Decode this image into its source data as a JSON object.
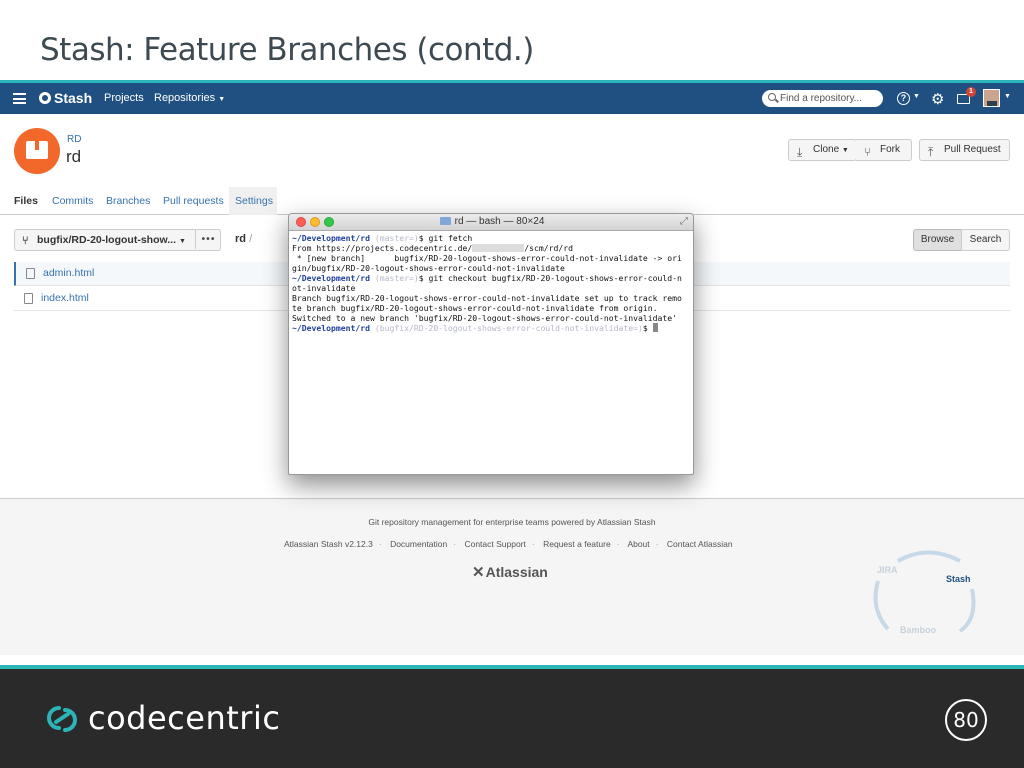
{
  "slide": {
    "title": "Stash: Feature Branches (contd.)",
    "brand": "codecentric",
    "page_number": "80",
    "accent_color": "#2bb5b8"
  },
  "topnav": {
    "logo": "Stash",
    "projects": "Projects",
    "repositories": "Repositories",
    "search_placeholder": "Find a repository...",
    "notification_count": "1",
    "nav_color": "#205081"
  },
  "repo": {
    "project": "RD",
    "name": "rd",
    "buttons": {
      "clone": "Clone",
      "fork": "Fork",
      "pull_request": "Pull Request"
    }
  },
  "tabs": [
    "Files",
    "Commits",
    "Branches",
    "Pull requests",
    "Settings"
  ],
  "files": {
    "branch": "bugfix/RD-20-logout-show...",
    "more": "•••",
    "path": "rd",
    "path_sep": "/",
    "browse": "Browse",
    "search": "Search",
    "items": [
      "admin.html",
      "index.html"
    ]
  },
  "footer": {
    "tagline": "Git repository management for enterprise teams powered by Atlassian Stash",
    "links": [
      "Atlassian Stash v2.12.3",
      "Documentation",
      "Contact Support",
      "Request a feature",
      "About",
      "Contact Atlassian"
    ],
    "logo": "Atlassian",
    "cycle": {
      "jira": "JIRA",
      "stash": "Stash",
      "bamboo": "Bamboo"
    }
  },
  "terminal": {
    "title": "rd — bash — 80×24",
    "prompt_path": "~/Development/rd",
    "l1_branch": " (master=)",
    "l1_cmd": "$ git fetch",
    "l2_a": "From https://projects.codecentric.de/",
    "l2_b": "/scm/rd/rd",
    "l3": " * [new branch]      bugfix/RD-20-logout-shows-error-could-not-invalidate -> ori",
    "l4": "gin/bugfix/RD-20-logout-shows-error-could-not-invalidate",
    "l5_branch": " (master=)",
    "l5_cmd": "$ git checkout bugfix/RD-20-logout-shows-error-could-n",
    "l6": "ot-invalidate",
    "l7": "Branch bugfix/RD-20-logout-shows-error-could-not-invalidate set up to track remo",
    "l8": "te branch bugfix/RD-20-logout-shows-error-could-not-invalidate from origin.",
    "l9": "Switched to a new branch 'bugfix/RD-20-logout-shows-error-could-not-invalidate'",
    "l10_branch": " (bugfix/RD-20-logout-shows-error-could-not-invalidate=)",
    "l10_cmd": "$ "
  }
}
